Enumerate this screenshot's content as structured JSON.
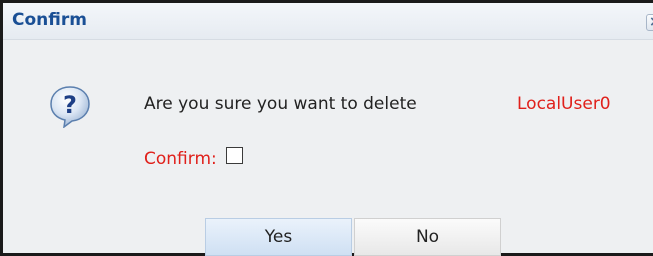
{
  "dialog": {
    "title": "Confirm",
    "close_glyph": "×",
    "icon": "question-icon",
    "message": "Are you sure you want to delete",
    "target_name": "LocalUser0",
    "confirm_label": "Confirm:",
    "confirm_checked": false,
    "buttons": {
      "yes_label": "Yes",
      "no_label": "No"
    }
  },
  "colors": {
    "title": "#1a4f95",
    "highlight_red": "#e0201b",
    "dialog_bg": "#eef0f2",
    "yes_button_bg": "#cfe0f3"
  }
}
